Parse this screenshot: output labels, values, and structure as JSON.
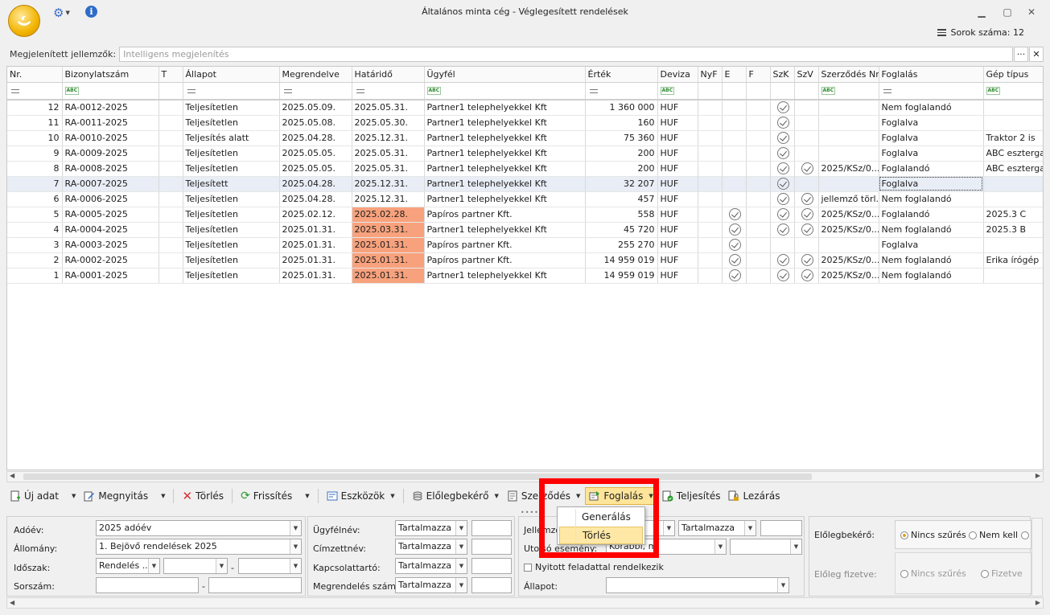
{
  "window": {
    "title": "Általános minta cég - Véglegesített rendelések",
    "row_count_label": "Sorok száma: 12"
  },
  "filterbar": {
    "label": "Megjelenített jellemzők:",
    "placeholder": "Intelligens megjelenítés",
    "more_label": "···",
    "close_label": "✕"
  },
  "columns": [
    "Nr.",
    "Bizonylatszám",
    "T",
    "Állapot",
    "Megrendelve",
    "Határidő",
    "Ügyfél",
    "Érték",
    "Deviza",
    "NyF",
    "E",
    "F",
    "SzK",
    "SzV",
    "Szerződés Nr.",
    "Foglalás",
    "Gép típus"
  ],
  "rows": [
    {
      "nr": "12",
      "doc": "RA-0012-2025",
      "status": "Teljesítetlen",
      "ordered": "2025.05.09.",
      "deadline": "2025.05.31.",
      "late": false,
      "customer": "Partner1 telephelyekkel Kft",
      "value": "1 360 000",
      "currency": "HUF",
      "e": false,
      "szk": true,
      "szv": false,
      "contract": "",
      "booking": "Nem foglalandó",
      "machine": ""
    },
    {
      "nr": "11",
      "doc": "RA-0011-2025",
      "status": "Teljesítetlen",
      "ordered": "2025.05.08.",
      "deadline": "2025.05.30.",
      "late": false,
      "customer": "Partner1 telephelyekkel Kft",
      "value": "160",
      "currency": "HUF",
      "e": false,
      "szk": true,
      "szv": false,
      "contract": "",
      "booking": "Foglalva",
      "machine": ""
    },
    {
      "nr": "10",
      "doc": "RA-0010-2025",
      "status": "Teljesítés alatt",
      "ordered": "2025.04.28.",
      "deadline": "2025.12.31.",
      "late": false,
      "customer": "Partner1 telephelyekkel Kft",
      "value": "75 360",
      "currency": "HUF",
      "e": false,
      "szk": true,
      "szv": false,
      "contract": "",
      "booking": "Foglalva",
      "machine": "Traktor 2 is"
    },
    {
      "nr": "9",
      "doc": "RA-0009-2025",
      "status": "Teljesítetlen",
      "ordered": "2025.05.05.",
      "deadline": "2025.05.31.",
      "late": false,
      "customer": "Partner1 telephelyekkel Kft",
      "value": "200",
      "currency": "HUF",
      "e": false,
      "szk": true,
      "szv": false,
      "contract": "",
      "booking": "Foglalva",
      "machine": "ABC esztergа"
    },
    {
      "nr": "8",
      "doc": "RA-0008-2025",
      "status": "Teljesítetlen",
      "ordered": "2025.05.05.",
      "deadline": "2025.05.31.",
      "late": false,
      "customer": "Partner1 telephelyekkel Kft",
      "value": "200",
      "currency": "HUF",
      "e": false,
      "szk": true,
      "szv": true,
      "contract": "2025/KSz/0...",
      "booking": "Foglalandó",
      "machine": "ABC esztergа"
    },
    {
      "nr": "7",
      "doc": "RA-0007-2025",
      "status": "Teljesített",
      "ordered": "2025.04.28.",
      "deadline": "2025.12.31.",
      "late": false,
      "customer": "Partner1 telephelyekkel Kft",
      "value": "32 207",
      "currency": "HUF",
      "e": false,
      "szk": true,
      "szv": false,
      "contract": "",
      "booking": "Foglalva",
      "machine": ""
    },
    {
      "nr": "6",
      "doc": "RA-0006-2025",
      "status": "Teljesítetlen",
      "ordered": "2025.04.28.",
      "deadline": "2025.12.31.",
      "late": false,
      "customer": "Partner1 telephelyekkel Kft",
      "value": "457",
      "currency": "HUF",
      "e": false,
      "szk": true,
      "szv": true,
      "contract": "jellemző törl...",
      "booking": "Nem foglalandó",
      "machine": ""
    },
    {
      "nr": "5",
      "doc": "RA-0005-2025",
      "status": "Teljesítetlen",
      "ordered": "2025.02.12.",
      "deadline": "2025.02.28.",
      "late": true,
      "customer": "Papíros partner Kft.",
      "value": "558",
      "currency": "HUF",
      "e": true,
      "szk": true,
      "szv": true,
      "contract": "2025/KSz/0...",
      "booking": "Foglalandó",
      "machine": "2025.3 C"
    },
    {
      "nr": "4",
      "doc": "RA-0004-2025",
      "status": "Teljesítetlen",
      "ordered": "2025.01.31.",
      "deadline": "2025.03.31.",
      "late": true,
      "customer": "Partner1 telephelyekkel Kft",
      "value": "45 720",
      "currency": "HUF",
      "e": true,
      "szk": true,
      "szv": true,
      "contract": "2025/KSz/0...",
      "booking": "Nem foglalandó",
      "machine": "2025.3 B"
    },
    {
      "nr": "3",
      "doc": "RA-0003-2025",
      "status": "Teljesítetlen",
      "ordered": "2025.01.31.",
      "deadline": "2025.01.31.",
      "late": true,
      "customer": "Papíros partner Kft.",
      "value": "255 270",
      "currency": "HUF",
      "e": true,
      "szk": false,
      "szv": false,
      "contract": "",
      "booking": "Foglalva",
      "machine": ""
    },
    {
      "nr": "2",
      "doc": "RA-0002-2025",
      "status": "Teljesítetlen",
      "ordered": "2025.01.31.",
      "deadline": "2025.01.31.",
      "late": true,
      "customer": "Papíros partner Kft.",
      "value": "14 959 019",
      "currency": "HUF",
      "e": true,
      "szk": true,
      "szv": true,
      "contract": "2025/KSz/0...",
      "booking": "Nem foglalandó",
      "machine": "Erika írógép"
    },
    {
      "nr": "1",
      "doc": "RA-0001-2025",
      "status": "Teljesítetlen",
      "ordered": "2025.01.31.",
      "deadline": "2025.01.31.",
      "late": true,
      "customer": "Partner1 telephelyekkel Kft",
      "value": "14 959 019",
      "currency": "HUF",
      "e": true,
      "szk": true,
      "szv": true,
      "contract": "2025/KSz/0...",
      "booking": "Nem foglalandó",
      "machine": ""
    }
  ],
  "toolbar": {
    "new": "Új adat",
    "open": "Megnyitás",
    "delete": "Törlés",
    "refresh": "Frissítés",
    "tools": "Eszközök",
    "prepay": "Előlegbekérő",
    "contract": "Szerződés",
    "booking": "Foglalás",
    "fulfil": "Teljesítés",
    "close": "Lezárás"
  },
  "booking_menu": {
    "generate": "Generálás",
    "delete": "Törlés"
  },
  "filters": {
    "year_label": "Adóév:",
    "year_value": "2025 adóév",
    "file_label": "Állomány:",
    "file_value": "1. Bejövő rendelések 2025",
    "period_label": "Időszak:",
    "period_value": "Rendelés ...",
    "period_dash": "-",
    "serial_label": "Sorszám:",
    "serial_dash": "-",
    "customer_label": "Ügyfélnév:",
    "contains": "Tartalmazza",
    "recipient_label": "Címzettnév:",
    "contact_label": "Kapcsolattartó:",
    "ordernum_label": "Megrendelés száma:",
    "feature_label": "Jellemző",
    "last_event_label": "Utolsó esemény:",
    "last_event_value": "Korábbi, mi",
    "open_task_label": "Nyitott feladattal rendelkezik",
    "state_label": "Állapot:",
    "prepay_req_label": "Előlegbekérő:",
    "prepay_pay_label": "Előleg fizetve:",
    "no_filter": "Nincs szűrés",
    "not_needed": "Nem kell",
    "paid": "Fizetve"
  },
  "colors": {
    "late": "#f8a27d",
    "accent": "#ffe59a",
    "highlight": "#ff0000"
  }
}
